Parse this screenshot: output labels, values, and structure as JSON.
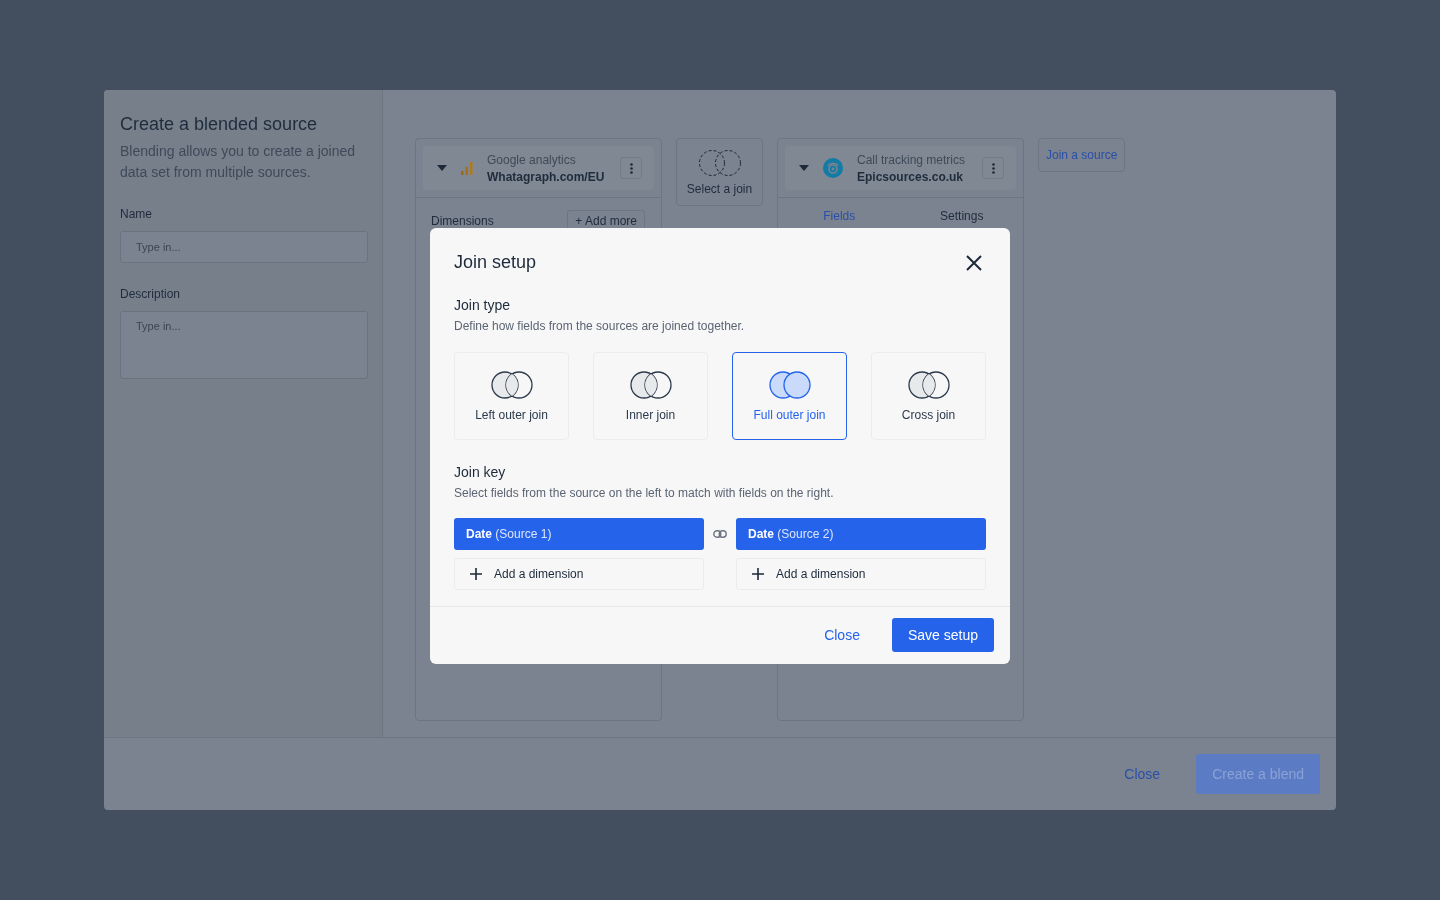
{
  "blend_panel": {
    "title": "Create a blended source",
    "description": "Blending allows you to create a joined data set from multiple sources.",
    "fields": [
      {
        "label": "Name",
        "placeholder": "Type in...",
        "kind": "input"
      },
      {
        "label": "Description",
        "placeholder": "Type in...",
        "kind": "textarea"
      }
    ]
  },
  "sources": [
    {
      "type": "Google analytics",
      "name": "Whatagraph.com/EU",
      "kind": "analytics",
      "dimensions_label": "Dimensions",
      "add_more": "+ Add more"
    },
    {
      "type": "Call tracking metrics",
      "name": "Epicsources.co.uk",
      "kind": "calltracking",
      "tabs": [
        {
          "label": "Fields",
          "selected": true
        },
        {
          "label": "Settings",
          "selected": false
        }
      ]
    }
  ],
  "join_placeholder": "Select a join",
  "join_source_button": "Join a source",
  "footer": {
    "close": "Close",
    "create": "Create a blend",
    "create_disabled": true
  },
  "dialog": {
    "title": "Join setup",
    "join_type": {
      "heading": "Join type",
      "hint": "Define how fields from the sources are joined together.",
      "options": [
        {
          "label": "Left outer join",
          "selected": false
        },
        {
          "label": "Inner join",
          "selected": false
        },
        {
          "label": "Full outer join",
          "selected": true
        },
        {
          "label": "Cross join",
          "selected": false
        }
      ]
    },
    "join_key": {
      "heading": "Join key",
      "hint": "Select fields from the source on the left to match with fields on the right.",
      "pairs": [
        {
          "left": "**Date** (Source 1)",
          "right": "**Date** (Source 2)"
        }
      ],
      "add_left": "Add a dimension",
      "add_right": "Add a dimension"
    },
    "close": "Close",
    "save": "Save setup"
  }
}
